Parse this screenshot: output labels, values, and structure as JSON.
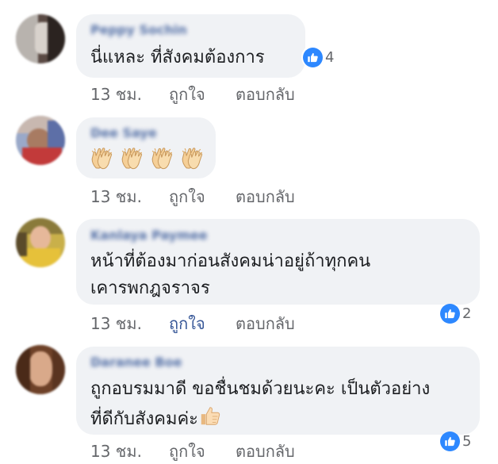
{
  "comments": [
    {
      "author": "Peppy Sochin",
      "text_lines": [
        "นี่แหละ ที่สังคมต้องการ"
      ],
      "time": "13 ชม.",
      "like_label": "ถูกใจ",
      "reply_label": "ตอบกลับ",
      "reactions": "4",
      "liked": false
    },
    {
      "author": "Dee Saye",
      "text_lines": [],
      "emoji": [
        "clapping-hands",
        "clapping-hands",
        "clapping-hands",
        "clapping-hands"
      ],
      "time": "13 ชม.",
      "like_label": "ถูกใจ",
      "reply_label": "ตอบกลับ",
      "liked": false
    },
    {
      "author": "Kanlaya Paymee",
      "text_lines": [
        "หน้าที่ต้องมาก่อนสังคมน่าอยู่ถ้าทุกคน",
        "เคารพกฎจราจร"
      ],
      "time": "13 ชม.",
      "like_label": "ถูกใจ",
      "reply_label": "ตอบกลับ",
      "reactions": "2",
      "liked": true
    },
    {
      "author": "Daranee Boe",
      "text_lines": [
        "ถูกอบรมมาดี ขอชื่นชมด้วยนะคะ เป็นตัวอย่าง",
        "ที่ดีกับสังคมค่ะ"
      ],
      "trailing_emoji": "thumbs-up",
      "time": "13 ชม.",
      "like_label": "ถูกใจ",
      "reply_label": "ตอบกลับ",
      "reactions": "5",
      "liked": false
    }
  ],
  "colors": {
    "bubble": "#f0f2f5",
    "like_blue": "#2d88ff",
    "name_blue": "#385898",
    "meta_gray": "#65676b",
    "skin": "#f5cf97"
  },
  "icons": {
    "reaction": "like-thumb-icon",
    "clap": "clapping-hands-emoji",
    "thumbs": "thumbs-up-emoji"
  }
}
